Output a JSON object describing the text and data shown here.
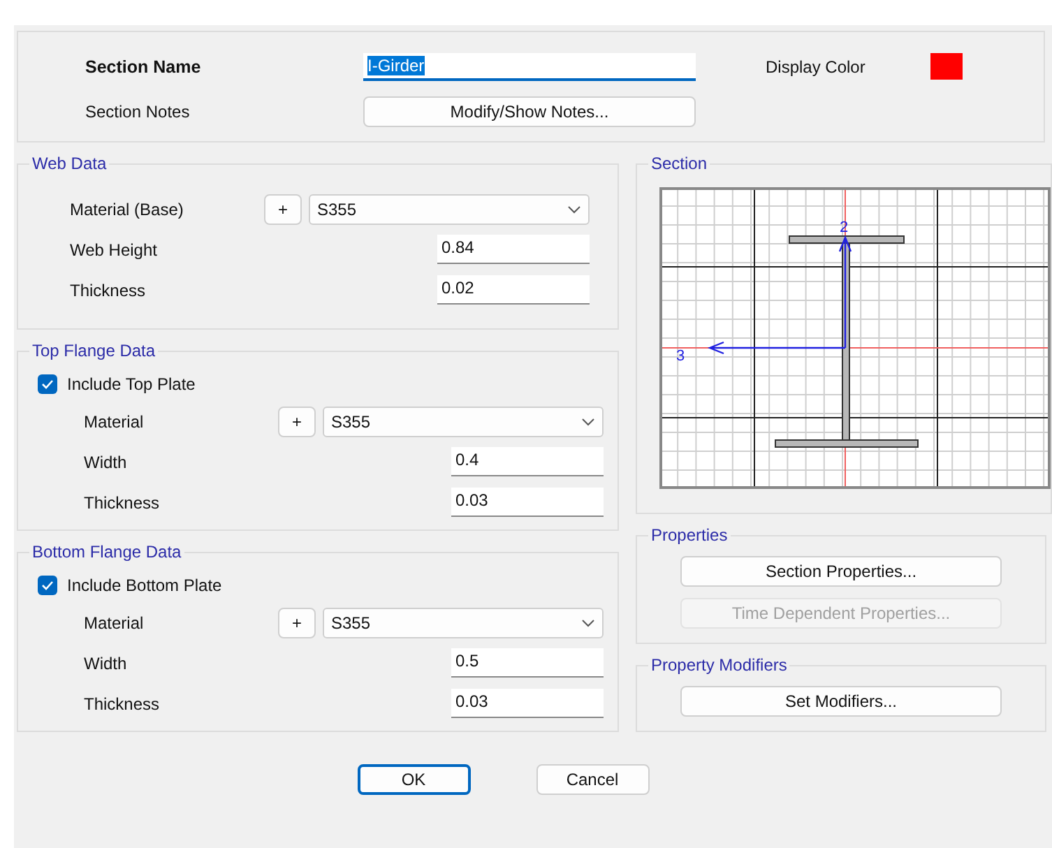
{
  "section_name": {
    "label": "Section Name",
    "value": "I-Girder",
    "text_selected": true
  },
  "display_color": {
    "label": "Display Color",
    "color": "#ff0000"
  },
  "section_notes": {
    "label": "Section Notes",
    "button": "Modify/Show Notes..."
  },
  "groups": [
    {
      "title": "Web Data",
      "rows": [
        {
          "kind": "material",
          "label": "Material (Base)",
          "add": "+",
          "value": "S355"
        },
        {
          "kind": "number",
          "label": "Web Height",
          "value": "0.84"
        },
        {
          "kind": "number",
          "label": "Thickness",
          "value": "0.02"
        }
      ]
    },
    {
      "title": "Top Flange Data",
      "include": {
        "label": "Include Top Plate",
        "checked": true
      },
      "rows": [
        {
          "kind": "material",
          "label": "Material",
          "add": "+",
          "value": "S355"
        },
        {
          "kind": "number",
          "label": "Width",
          "value": "0.4"
        },
        {
          "kind": "number",
          "label": "Thickness",
          "value": "0.03"
        }
      ]
    },
    {
      "title": "Bottom Flange Data",
      "include": {
        "label": "Include Bottom Plate",
        "checked": true
      },
      "rows": [
        {
          "kind": "material",
          "label": "Material",
          "add": "+",
          "value": "S355"
        },
        {
          "kind": "number",
          "label": "Width",
          "value": "0.5"
        },
        {
          "kind": "number",
          "label": "Thickness",
          "value": "0.03"
        }
      ]
    }
  ],
  "section": {
    "title": "Section",
    "axis_labels": [
      "2",
      "3"
    ]
  },
  "properties": {
    "title": "Properties",
    "buttons": [
      {
        "label": "Section Properties...",
        "disabled": false
      },
      {
        "label": "Time Dependent Properties...",
        "disabled": true
      }
    ]
  },
  "modifiers": {
    "title": "Property Modifiers",
    "buttons": [
      {
        "label": "Set Modifiers...",
        "disabled": false
      }
    ]
  },
  "footer": [
    {
      "label": "OK",
      "default": true
    },
    {
      "label": "Cancel",
      "default": false
    }
  ]
}
